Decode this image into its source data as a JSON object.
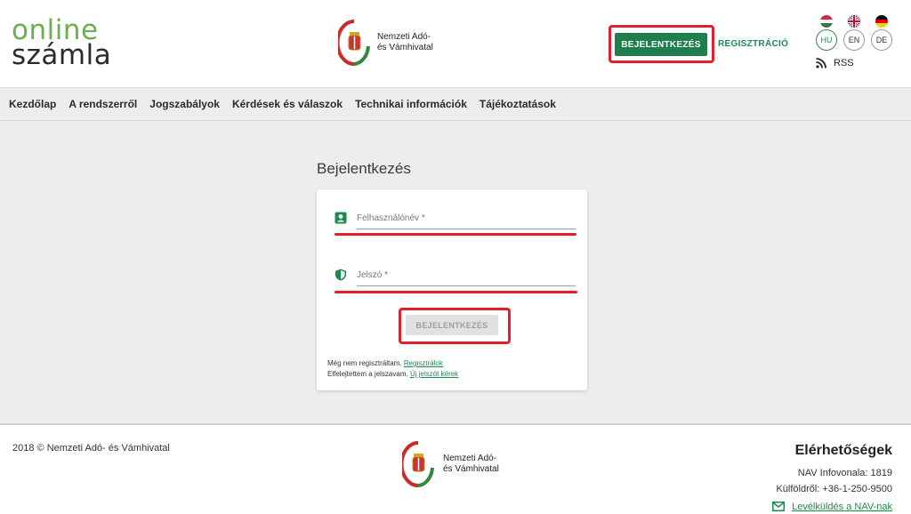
{
  "header": {
    "logo_line1": "online",
    "logo_line2": "számla",
    "nav_name": "Nemzeti Adó-\nés Vámhivatal",
    "login_label": "BEJELENTKEZÉS",
    "register_label": "REGISZTRÁCIÓ",
    "languages": [
      {
        "code": "HU",
        "active": true
      },
      {
        "code": "EN",
        "active": false
      },
      {
        "code": "DE",
        "active": false
      }
    ],
    "rss_label": "RSS"
  },
  "nav": {
    "items": [
      "Kezdőlap",
      "A rendszerről",
      "Jogszabályok",
      "Kérdések és válaszok",
      "Technikai információk",
      "Tájékoztatások"
    ]
  },
  "main": {
    "title": "Bejelentkezés",
    "username_placeholder": "Felhasználónév *",
    "password_placeholder": "Jelszó *",
    "submit_label": "BEJELENTKEZÉS",
    "not_registered_text": "Még nem regisztráltam.",
    "register_link": "Regisztrálok",
    "forgot_text": "Elfelejtettem a jelszavam.",
    "new_password_link": "Új jelszót kérek"
  },
  "footer": {
    "copyright": "2018 © Nemzeti Adó- és Vámhivatal",
    "nav_name": "Nemzeti Adó-\nés Vámhivatal",
    "contacts_title": "Elérhetőségek",
    "infovonal": "NAV Infovonala: 1819",
    "kulfold": "Külföldről: +36-1-250-9500",
    "mail_link": "Levélküldés a NAV-nak"
  },
  "colors": {
    "brand_green": "#1f7e4d",
    "highlight_red": "#e0202b",
    "logo_green": "#6ab04c"
  }
}
